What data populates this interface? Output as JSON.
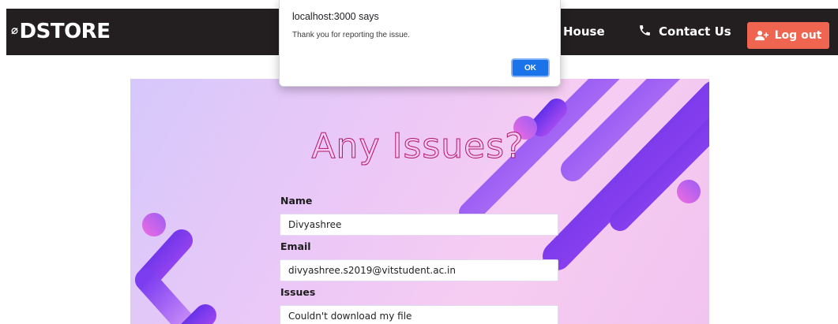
{
  "navbar": {
    "brand": "DSTORE",
    "links": {
      "house": "House",
      "contact": "Contact Us"
    },
    "logout_label": "Log out",
    "colors": {
      "background": "#231f20",
      "logout": "#f0654f"
    }
  },
  "hero": {
    "title": "Any Issues?",
    "fields": {
      "name": {
        "label": "Name",
        "value": "Divyashree"
      },
      "email": {
        "label": "Email",
        "value": "divyashree.s2019@vitstudent.ac.in"
      },
      "issues": {
        "label": "Issues",
        "value": "Couldn't download my file"
      }
    }
  },
  "dialog": {
    "title": "localhost:3000 says",
    "message": "Thank you for reporting the issue.",
    "ok_label": "OK",
    "accent": "#1a73e8"
  },
  "icons": [
    "brand-logo-icon",
    "phone-icon",
    "user-plus-icon"
  ]
}
